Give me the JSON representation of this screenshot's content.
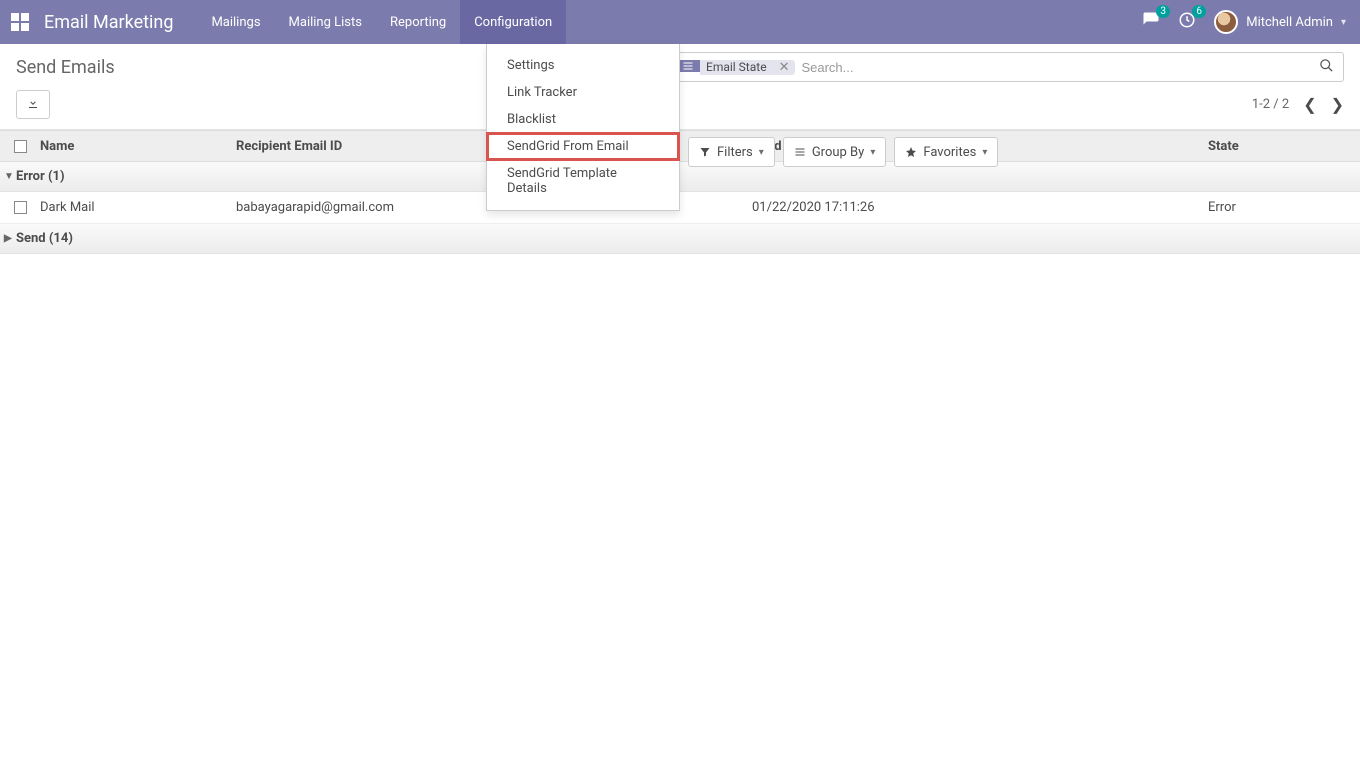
{
  "navbar": {
    "app_title": "Email Marketing",
    "menu": [
      {
        "label": "Mailings"
      },
      {
        "label": "Mailing Lists"
      },
      {
        "label": "Reporting"
      },
      {
        "label": "Configuration"
      }
    ],
    "active_menu_index": 3,
    "dropdown": {
      "items": [
        {
          "label": "Settings"
        },
        {
          "label": "Link Tracker"
        },
        {
          "label": "Blacklist"
        },
        {
          "label": "SendGrid From Email",
          "highlighted": true
        },
        {
          "label": "SendGrid Template Details"
        }
      ]
    },
    "notif1_count": "3",
    "notif2_count": "6",
    "user_name": "Mitchell Admin"
  },
  "cp": {
    "title": "Send Emails",
    "search_placeholder": "Search...",
    "facet_label": "Email State",
    "filters_label": "Filters",
    "groupby_label": "Group By",
    "favorites_label": "Favorites",
    "pager_text": "1-2 / 2"
  },
  "table": {
    "columns": {
      "name": "Name",
      "email": "Recipient Email ID",
      "date": "Send Date",
      "state": "State"
    },
    "groups": [
      {
        "label": "Error (1)",
        "expanded": true,
        "rows": [
          {
            "name": "Dark Mail",
            "email": "babayagarapid@gmail.com",
            "date": "01/22/2020 17:11:26",
            "state": "Error"
          }
        ]
      },
      {
        "label": "Send (14)",
        "expanded": false,
        "rows": []
      }
    ]
  }
}
